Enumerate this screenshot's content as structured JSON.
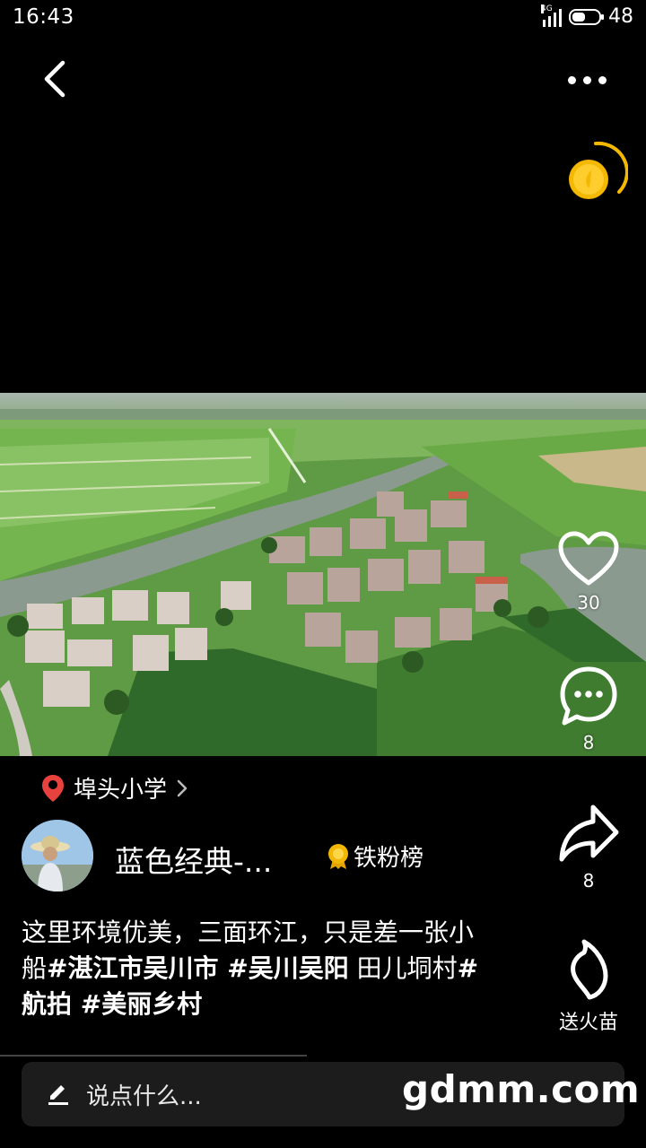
{
  "status_bar": {
    "time": "16:43",
    "network": "4G",
    "battery": "48"
  },
  "post": {
    "likes": "30",
    "comments": "8",
    "shares": "8",
    "gift_label": "送火苗"
  },
  "location": {
    "name": "埠头小学"
  },
  "author": {
    "name": "蓝色经典-...",
    "badge": "铁粉榜"
  },
  "caption": {
    "text1": "这里环境优美，三面环江，只是差一张小船",
    "tag1": "#湛江市吴川市 ",
    "tag2": "#吴川吴阳",
    "text2": " 田儿垌村",
    "tag3": "#航拍 ",
    "tag4": "#美丽乡村"
  },
  "comment_bar": {
    "placeholder": "说点什么..."
  },
  "watermark": "gdmm.com",
  "colors": {
    "background": "#000000",
    "location_pin": "#e8423f",
    "coin": "#f5b800",
    "badge": "#f2b705"
  }
}
